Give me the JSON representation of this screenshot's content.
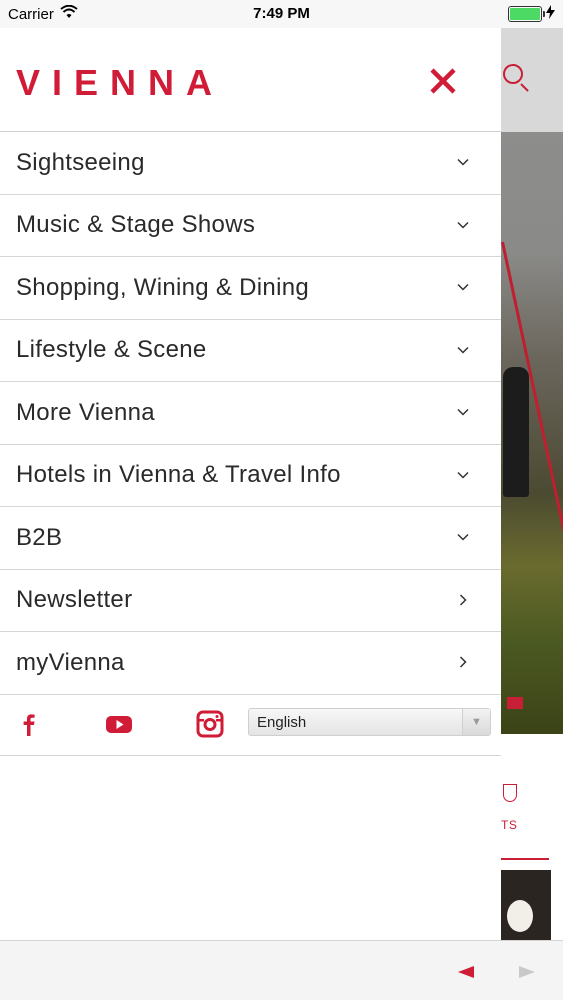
{
  "status_bar": {
    "carrier": "Carrier",
    "time": "7:49 PM",
    "battery_color": "#4cd964"
  },
  "drawer": {
    "logo": "VIENNA",
    "close_icon": "close-icon",
    "accent_color": "#d01c36",
    "menu_items": [
      {
        "label": "Sightseeing",
        "icon": "chevron-down-icon"
      },
      {
        "label": "Music & Stage Shows",
        "icon": "chevron-down-icon"
      },
      {
        "label": "Shopping, Wining & Dining",
        "icon": "chevron-down-icon"
      },
      {
        "label": "Lifestyle & Scene",
        "icon": "chevron-down-icon"
      },
      {
        "label": "More Vienna",
        "icon": "chevron-down-icon"
      },
      {
        "label": "Hotels in Vienna & Travel Info",
        "icon": "chevron-down-icon"
      },
      {
        "label": "B2B",
        "icon": "chevron-down-icon"
      },
      {
        "label": "Newsletter",
        "icon": "chevron-right-icon"
      },
      {
        "label": "myVienna",
        "icon": "chevron-right-icon"
      }
    ],
    "social": {
      "icons": [
        "facebook-icon",
        "youtube-icon",
        "instagram-icon"
      ],
      "language_selected": "English"
    }
  },
  "background": {
    "category_label": "TS"
  },
  "toolbar": {
    "back_icon": "back-arrow-icon",
    "forward_icon": "forward-arrow-icon"
  }
}
